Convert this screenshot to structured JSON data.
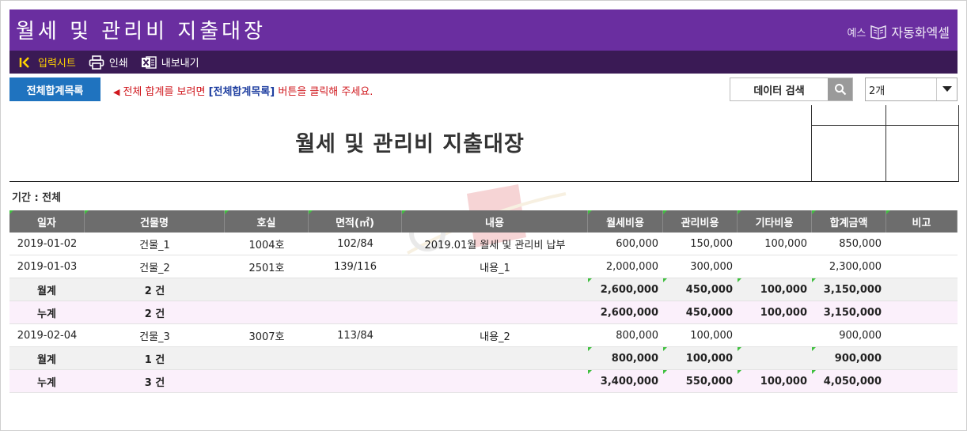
{
  "app": {
    "title": "월세 및 관리비 지출대장",
    "brand_logo": "예스",
    "brand_name": "자동화엑셀"
  },
  "toolbar": {
    "input_sheet": "입력시트",
    "print": "인쇄",
    "export": "내보내기"
  },
  "controls": {
    "total_list_button": "전체합계목록",
    "hint_prefix": "전체 합계를 보려면",
    "hint_link": "[전체합계목록]",
    "hint_suffix": "버튼을 클릭해 주세요.",
    "search_label": "데이터 검색",
    "select_value": "2개"
  },
  "report": {
    "title": "월세 및 관리비 지출대장",
    "period": "기간 : 전체"
  },
  "table": {
    "headers": [
      "일자",
      "건물명",
      "호실",
      "면적(㎡)",
      "내용",
      "월세비용",
      "관리비용",
      "기타비용",
      "합계금액",
      "비고"
    ],
    "rows": [
      {
        "type": "data",
        "date": "2019-01-02",
        "building": "건물_1",
        "room": "1004호",
        "area": "102/84",
        "content": "2019.01월 월세 및 관리비 납부",
        "rent": "600,000",
        "mgmt": "150,000",
        "other": "100,000",
        "total": "850,000",
        "note": ""
      },
      {
        "type": "data",
        "date": "2019-01-03",
        "building": "건물_2",
        "room": "2501호",
        "area": "139/116",
        "content": "내용_1",
        "rent": "2,000,000",
        "mgmt": "300,000",
        "other": "",
        "total": "2,300,000",
        "note": ""
      },
      {
        "type": "sub",
        "label": "월계",
        "count": "2 건",
        "rent": "2,600,000",
        "mgmt": "450,000",
        "other": "100,000",
        "total": "3,150,000"
      },
      {
        "type": "cum",
        "label": "누계",
        "count": "2 건",
        "rent": "2,600,000",
        "mgmt": "450,000",
        "other": "100,000",
        "total": "3,150,000"
      },
      {
        "type": "data",
        "date": "2019-02-04",
        "building": "건물_3",
        "room": "3007호",
        "area": "113/84",
        "content": "내용_2",
        "rent": "800,000",
        "mgmt": "100,000",
        "other": "",
        "total": "900,000",
        "note": ""
      },
      {
        "type": "sub",
        "label": "월계",
        "count": "1 건",
        "rent": "800,000",
        "mgmt": "100,000",
        "other": "",
        "total": "900,000"
      },
      {
        "type": "cum",
        "label": "누계",
        "count": "3 건",
        "rent": "3,400,000",
        "mgmt": "550,000",
        "other": "100,000",
        "total": "4,050,000"
      }
    ]
  },
  "colors": {
    "title_bar": "#6a2ea0",
    "toolbar": "#3a1a55",
    "accent_button": "#1f73bf",
    "hint_text": "#d0181e",
    "table_header": "#6d6d6d"
  }
}
